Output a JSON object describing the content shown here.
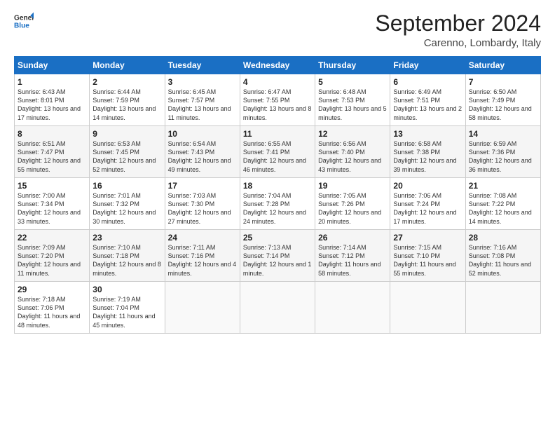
{
  "header": {
    "logo_line1": "General",
    "logo_line2": "Blue",
    "month": "September 2024",
    "location": "Carenno, Lombardy, Italy"
  },
  "weekdays": [
    "Sunday",
    "Monday",
    "Tuesday",
    "Wednesday",
    "Thursday",
    "Friday",
    "Saturday"
  ],
  "weeks": [
    [
      {
        "day": "1",
        "sunrise": "6:43 AM",
        "sunset": "8:01 PM",
        "daylight": "13 hours and 17 minutes."
      },
      {
        "day": "2",
        "sunrise": "6:44 AM",
        "sunset": "7:59 PM",
        "daylight": "13 hours and 14 minutes."
      },
      {
        "day": "3",
        "sunrise": "6:45 AM",
        "sunset": "7:57 PM",
        "daylight": "13 hours and 11 minutes."
      },
      {
        "day": "4",
        "sunrise": "6:47 AM",
        "sunset": "7:55 PM",
        "daylight": "13 hours and 8 minutes."
      },
      {
        "day": "5",
        "sunrise": "6:48 AM",
        "sunset": "7:53 PM",
        "daylight": "13 hours and 5 minutes."
      },
      {
        "day": "6",
        "sunrise": "6:49 AM",
        "sunset": "7:51 PM",
        "daylight": "13 hours and 2 minutes."
      },
      {
        "day": "7",
        "sunrise": "6:50 AM",
        "sunset": "7:49 PM",
        "daylight": "12 hours and 58 minutes."
      }
    ],
    [
      {
        "day": "8",
        "sunrise": "6:51 AM",
        "sunset": "7:47 PM",
        "daylight": "12 hours and 55 minutes."
      },
      {
        "day": "9",
        "sunrise": "6:53 AM",
        "sunset": "7:45 PM",
        "daylight": "12 hours and 52 minutes."
      },
      {
        "day": "10",
        "sunrise": "6:54 AM",
        "sunset": "7:43 PM",
        "daylight": "12 hours and 49 minutes."
      },
      {
        "day": "11",
        "sunrise": "6:55 AM",
        "sunset": "7:41 PM",
        "daylight": "12 hours and 46 minutes."
      },
      {
        "day": "12",
        "sunrise": "6:56 AM",
        "sunset": "7:40 PM",
        "daylight": "12 hours and 43 minutes."
      },
      {
        "day": "13",
        "sunrise": "6:58 AM",
        "sunset": "7:38 PM",
        "daylight": "12 hours and 39 minutes."
      },
      {
        "day": "14",
        "sunrise": "6:59 AM",
        "sunset": "7:36 PM",
        "daylight": "12 hours and 36 minutes."
      }
    ],
    [
      {
        "day": "15",
        "sunrise": "7:00 AM",
        "sunset": "7:34 PM",
        "daylight": "12 hours and 33 minutes."
      },
      {
        "day": "16",
        "sunrise": "7:01 AM",
        "sunset": "7:32 PM",
        "daylight": "12 hours and 30 minutes."
      },
      {
        "day": "17",
        "sunrise": "7:03 AM",
        "sunset": "7:30 PM",
        "daylight": "12 hours and 27 minutes."
      },
      {
        "day": "18",
        "sunrise": "7:04 AM",
        "sunset": "7:28 PM",
        "daylight": "12 hours and 24 minutes."
      },
      {
        "day": "19",
        "sunrise": "7:05 AM",
        "sunset": "7:26 PM",
        "daylight": "12 hours and 20 minutes."
      },
      {
        "day": "20",
        "sunrise": "7:06 AM",
        "sunset": "7:24 PM",
        "daylight": "12 hours and 17 minutes."
      },
      {
        "day": "21",
        "sunrise": "7:08 AM",
        "sunset": "7:22 PM",
        "daylight": "12 hours and 14 minutes."
      }
    ],
    [
      {
        "day": "22",
        "sunrise": "7:09 AM",
        "sunset": "7:20 PM",
        "daylight": "12 hours and 11 minutes."
      },
      {
        "day": "23",
        "sunrise": "7:10 AM",
        "sunset": "7:18 PM",
        "daylight": "12 hours and 8 minutes."
      },
      {
        "day": "24",
        "sunrise": "7:11 AM",
        "sunset": "7:16 PM",
        "daylight": "12 hours and 4 minutes."
      },
      {
        "day": "25",
        "sunrise": "7:13 AM",
        "sunset": "7:14 PM",
        "daylight": "12 hours and 1 minute."
      },
      {
        "day": "26",
        "sunrise": "7:14 AM",
        "sunset": "7:12 PM",
        "daylight": "11 hours and 58 minutes."
      },
      {
        "day": "27",
        "sunrise": "7:15 AM",
        "sunset": "7:10 PM",
        "daylight": "11 hours and 55 minutes."
      },
      {
        "day": "28",
        "sunrise": "7:16 AM",
        "sunset": "7:08 PM",
        "daylight": "11 hours and 52 minutes."
      }
    ],
    [
      {
        "day": "29",
        "sunrise": "7:18 AM",
        "sunset": "7:06 PM",
        "daylight": "11 hours and 48 minutes."
      },
      {
        "day": "30",
        "sunrise": "7:19 AM",
        "sunset": "7:04 PM",
        "daylight": "11 hours and 45 minutes."
      },
      null,
      null,
      null,
      null,
      null
    ]
  ]
}
